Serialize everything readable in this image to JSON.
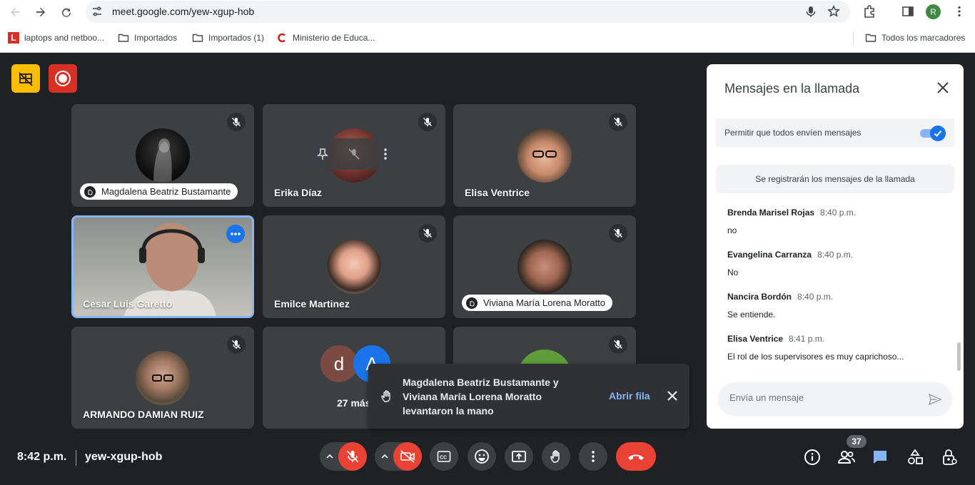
{
  "browser": {
    "url": "meet.google.com/yew-xgup-hob",
    "profile_initial": "R",
    "bookmarks": [
      {
        "label": "laptops and netboo...",
        "icon": "l-logo-icon"
      },
      {
        "label": "Importados",
        "icon": "folder-icon"
      },
      {
        "label": "Importados (1)",
        "icon": "folder-icon"
      },
      {
        "label": "Ministerio de Educa...",
        "icon": "c-logo-icon"
      }
    ],
    "all_bookmarks": "Todos los marcadores"
  },
  "tiles": [
    {
      "name": "Magdalena Beatriz Bustamante",
      "hand_raised": true
    },
    {
      "name": "Erika Díaz"
    },
    {
      "name": "Elisa Ventrice"
    },
    {
      "name": "Cesar Luis Garetto"
    },
    {
      "name": "Emilce Martinez"
    },
    {
      "name": "Viviana María Lorena Moratto",
      "hand_raised": true
    },
    {
      "name": "ARMANDO DAMIAN RUIZ"
    },
    {
      "name": "27 más",
      "avatars": [
        "d",
        "A"
      ]
    }
  ],
  "toast": {
    "message": "Magdalena Beatriz Bustamante y Viviana María Lorena Moratto levantaron la mano",
    "action": "Abrir fila"
  },
  "chat": {
    "title": "Mensajes en la llamada",
    "allow_label": "Permitir que todos envíen mensajes",
    "allow_enabled": true,
    "notice": "Se registrarán los mensajes de la llamada",
    "messages": [
      {
        "sender": "Brenda Marisel Rojas",
        "time": "8:40 p.m.",
        "text": "no"
      },
      {
        "sender": "Evangelina Carranza",
        "time": "8:40 p.m.",
        "text": "No"
      },
      {
        "sender": "Nancira Bordón",
        "time": "8:40 p.m.",
        "text": "Se entiende."
      },
      {
        "sender": "Elisa Ventrice",
        "time": "8:41 p.m.",
        "text": "El rol de los supervisores es muy caprichoso..."
      }
    ],
    "input_placeholder": "Envía un mensaje"
  },
  "bottom": {
    "time": "8:42 p.m.",
    "meeting_code": "yew-xgup-hob",
    "participants_count": "37"
  },
  "colors": {
    "accent": "#1a73e8",
    "danger": "#ea4335",
    "record": "#d93025",
    "warning": "#fbbc04"
  }
}
